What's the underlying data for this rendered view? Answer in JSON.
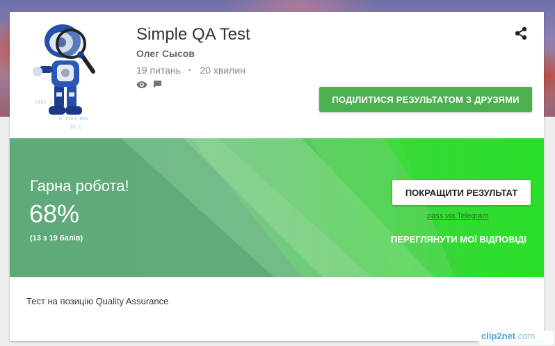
{
  "quiz": {
    "title": "Simple QA Test",
    "author": "Олег Сысов",
    "questions": "19 питань",
    "separator": "•",
    "duration": "20 хвилин",
    "icons": [
      "eye-icon",
      "comment-icon",
      "share-icon"
    ]
  },
  "actions": {
    "share_with_friends": "ПОДІЛИТИСЯ РЕЗУЛЬТАТОМ З ДРУЗЯМИ",
    "improve_result": "ПОКРАЩИТИ РЕЗУЛЬТАТ",
    "pass_via_telegram": "pass via Telegram",
    "review_answers": "ПЕРЕГЛЯНУТИ МОЇ ВІДПОВІДІ"
  },
  "result": {
    "praise": "Гарна робота!",
    "percent": "68%",
    "score": "(13 з 19 балів)",
    "score_value": 13,
    "score_max": 19
  },
  "description": "Тест на позицію Quality Assurance",
  "watermark": {
    "main": "clip2net",
    "tail": ".com"
  },
  "colors": {
    "accent_green": "#4caf50",
    "result_bright": "#22dd22",
    "result_muted": "#5fa87a"
  }
}
